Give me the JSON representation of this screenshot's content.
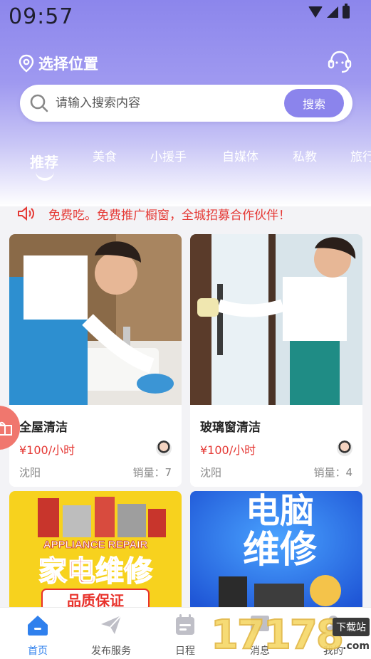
{
  "status_bar": {
    "time": "09:57"
  },
  "location": {
    "label": "选择位置"
  },
  "search": {
    "placeholder": "请输入搜索内容",
    "button_label": "搜索"
  },
  "tabs": [
    {
      "label": "推荐",
      "active": true
    },
    {
      "label": "美食"
    },
    {
      "label": "小援手"
    },
    {
      "label": "自媒体"
    },
    {
      "label": "私教"
    },
    {
      "label": "旅行"
    }
  ],
  "notice": {
    "text": "免费吃。免费推广橱窗，全城招募合作伙伴！"
  },
  "cards": [
    {
      "title": "全屋清洁",
      "price": "¥100/小时",
      "city": "沈阳",
      "sales": "销量：7"
    },
    {
      "title": "玻璃窗清洁",
      "price": "¥100/小时",
      "city": "沈阳",
      "sales": "销量：4"
    },
    {
      "banner_en": "APPLIANCE REPAIR",
      "banner_cn": "家电维修",
      "banner_sub": "品质保证"
    },
    {
      "banner_cn_1": "电脑",
      "banner_cn_2": "维修"
    }
  ],
  "bottom_nav": [
    {
      "label": "首页",
      "icon": "home-icon",
      "active": true
    },
    {
      "label": "发布服务",
      "icon": "send-icon"
    },
    {
      "label": "日程",
      "icon": "calendar-icon"
    },
    {
      "label": "消息",
      "icon": "message-icon"
    },
    {
      "label": "我的",
      "icon": "profile-icon"
    }
  ],
  "watermark": {
    "digits": "17178",
    "badge": "下载站",
    "site": ".com"
  },
  "colors": {
    "accent": "#8b84ec",
    "price": "#e53935",
    "nav_active": "#2f80ed"
  }
}
